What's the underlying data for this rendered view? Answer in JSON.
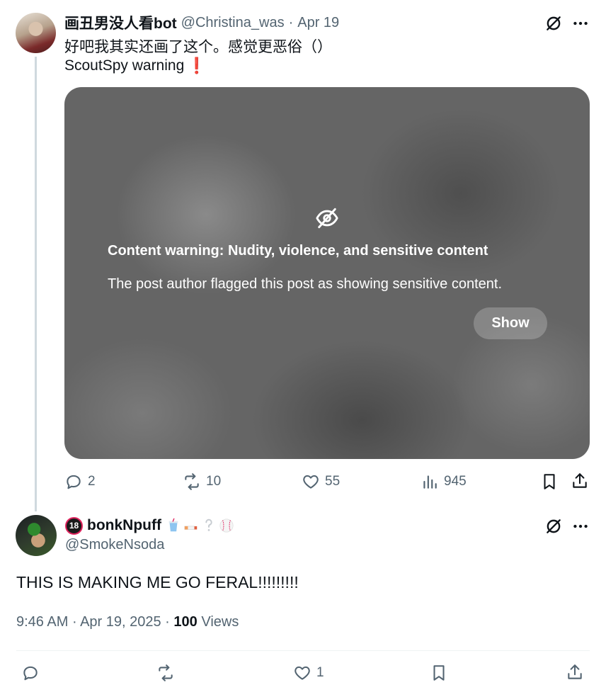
{
  "tweet1": {
    "display_name": "画丑男没人看bot",
    "handle": "@Christina_was",
    "separator": "·",
    "date": "Apr 19",
    "text_line1": "好吧我其实还画了这个。感觉更恶俗（）",
    "text_line2": "ScoutSpy warning",
    "text_line2_emoji": "❗",
    "media": {
      "warning_title": "Content warning: Nudity, violence, and sensitive content",
      "warning_desc": "The post author flagged this post as showing sensitive content.",
      "show_label": "Show",
      "icon": "eye-off-icon"
    },
    "actions": {
      "replies": "2",
      "reposts": "10",
      "likes": "55",
      "views": "945"
    }
  },
  "tweet2": {
    "badge": "18",
    "display_name": "bonkNpuff",
    "emojis": [
      "soda-cup-emoji",
      "cigarette-emoji",
      "question-mark-emoji",
      "baseball-emoji"
    ],
    "handle": "@SmokeNsoda",
    "text": "THIS IS MAKING ME GO FERAL!!!!!!!!!",
    "time": "9:46 AM",
    "date": "Apr 19, 2025",
    "meta_separator": "·",
    "views_count": "100",
    "views_label": "Views",
    "actions": {
      "likes": "1"
    }
  },
  "colors": {
    "text_primary": "#0f1419",
    "text_secondary": "#536471",
    "thread_line": "#cfd9de",
    "divider": "#eff3f4",
    "media_gray": "#656565",
    "alert_red": "#e0245e"
  }
}
